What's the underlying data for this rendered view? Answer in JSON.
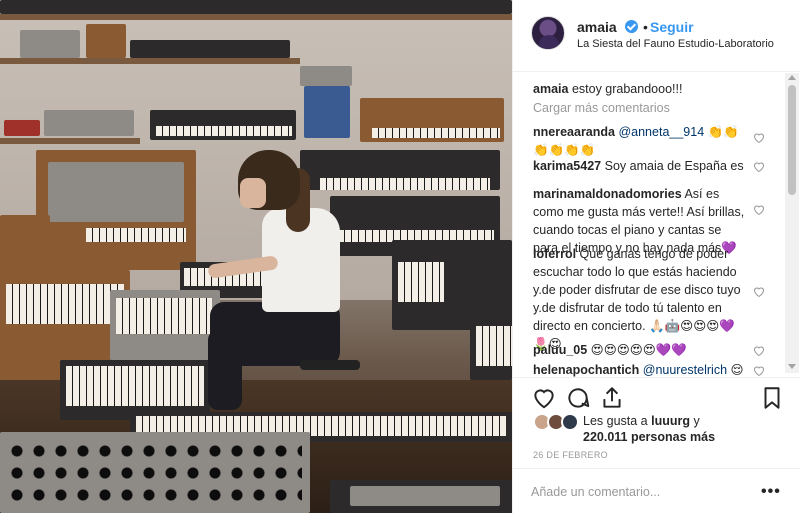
{
  "post": {
    "image_alt_icon": "photo-studio-synthesizers"
  },
  "header": {
    "username": "amaia",
    "dot": "•",
    "follow_label": "Seguir",
    "location": "La Siesta del Fauno Estudio-Laboratorio"
  },
  "caption": {
    "username": "amaia",
    "text": "estoy grabandooo!!!"
  },
  "load_more": "Cargar más comentarios",
  "comments": [
    {
      "user": "nnereaaranda",
      "mention": "@anneta__914",
      "text": " 👏👏👏👏👏👏"
    },
    {
      "user": "karima5427",
      "mention": "",
      "text": "Soy amaia de España es"
    },
    {
      "user": "marinamaldonadomories",
      "mention": "",
      "text": "Así es como me gusta más verte!! Así brillas, cuando tocas el piano y cantas se para el tiempo y no hay nada más💜"
    },
    {
      "user": "loferrol",
      "mention": "",
      "text": "Que ganas tengo de poder escuchar todo lo que estás haciendo y.de poder disfrutar de ese disco tuyo y.de disfrutar de todo tú talento en directo en concierto. 🙏🏻🤖😍😍😍💜🌷😍"
    },
    {
      "user": "paluu_05",
      "mention": "",
      "text": "😍😍😍😍😍💜💜"
    },
    {
      "user": "helenapochantich",
      "mention": "@nuurestelrich",
      "text": " 😌"
    }
  ],
  "likes": {
    "line1_prefix": "Les gusta a ",
    "line1_user": "luuurg",
    "line1_suffix": " y",
    "line2_count": "220.011 personas más"
  },
  "date": "26 DE FEBRERO",
  "add_comment_placeholder": "Añade un comentario...",
  "more_label": "•••",
  "colors": {
    "link_blue": "#3897f0",
    "text": "#262626",
    "muted": "#999999",
    "mention": "#003569",
    "border": "#efefef"
  },
  "icons": [
    "verified-icon",
    "heart-icon",
    "comment-icon",
    "share-icon",
    "bookmark-icon",
    "more-options-icon"
  ]
}
